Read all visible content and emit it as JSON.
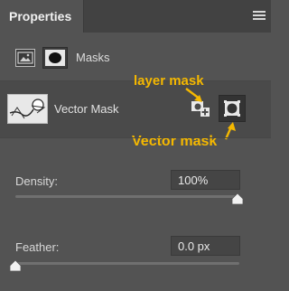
{
  "tabs": [
    {
      "label": "Properties"
    }
  ],
  "masks_section": {
    "label": "Masks"
  },
  "vector_section": {
    "label": "Vector Mask"
  },
  "annotations": {
    "layer_mask": "layer mask",
    "vector_mask": "Vector mask",
    "color": "#f5b800"
  },
  "density": {
    "label": "Density:",
    "value": "100%",
    "slider_fraction": 1.0
  },
  "feather": {
    "label": "Feather:",
    "value": "0.0 px",
    "slider_fraction": 0.0
  }
}
